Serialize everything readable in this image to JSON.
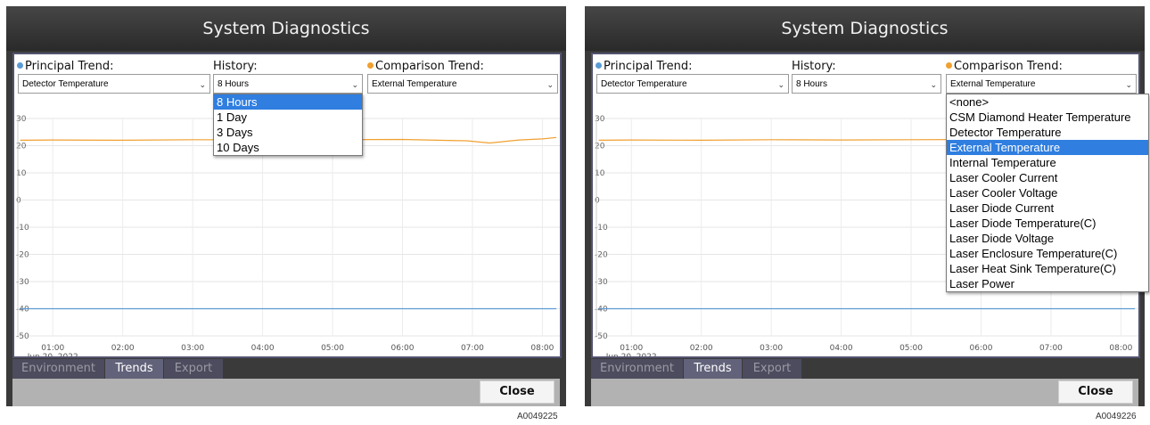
{
  "title": "System Diagnostics",
  "principal_label": "Principal Trend:",
  "history_label": "History:",
  "comparison_label": "Comparison Trend:",
  "colors": {
    "principal": "#5b9bd5",
    "comparison": "#f0a030",
    "selected_option": "#2f7ee0"
  },
  "panels": [
    {
      "principal_value": "Detector Temperature",
      "history_value": "8 Hours",
      "comparison_value": "External Temperature",
      "open_dropdown": "history",
      "dropdown_options": [
        "8 Hours",
        "1 Day",
        "3 Days",
        "10 Days"
      ],
      "selected_option": "8 Hours",
      "figure_code": "A0049225"
    },
    {
      "principal_value": "Detector Temperature",
      "history_value": "8 Hours",
      "comparison_value": "External Temperature",
      "open_dropdown": "comparison",
      "dropdown_options": [
        "<none>",
        "CSM Diamond Heater Temperature",
        "Detector Temperature",
        "External Temperature",
        "Internal Temperature",
        "Laser Cooler Current",
        "Laser Cooler Voltage",
        "Laser Diode Current",
        "Laser Diode Temperature(C)",
        "Laser Diode Voltage",
        "Laser Enclosure Temperature(C)",
        "Laser Heat Sink Temperature(C)",
        "Laser Power"
      ],
      "selected_option": "External Temperature",
      "figure_code": "A0049226"
    }
  ],
  "tabs": [
    "Environment",
    "Trends",
    "Export"
  ],
  "active_tab": "Trends",
  "close_label": "Close",
  "chart_data": {
    "type": "line",
    "x_ticks": [
      "01:00",
      "02:00",
      "03:00",
      "04:00",
      "05:00",
      "06:00",
      "07:00",
      "08:00"
    ],
    "x_date_label": "Jun 20, 2022",
    "y_ticks": [
      30,
      20,
      10,
      0,
      -10,
      -20,
      -30,
      -40,
      -50
    ],
    "ylim": [
      -50,
      30
    ],
    "grid": true,
    "series": [
      {
        "color": "#f0a030",
        "x": [
          "00:32",
          "01:00",
          "02:00",
          "03:00",
          "04:00",
          "05:00",
          "06:00",
          "06:30",
          "06:55",
          "07:15",
          "07:40",
          "08:00",
          "08:12"
        ],
        "values": [
          22,
          22.1,
          22,
          22.2,
          22.1,
          22.2,
          22.3,
          22,
          21.8,
          21,
          22.1,
          22.5,
          23
        ]
      },
      {
        "color": "#5b9bd5",
        "x": [
          "00:32",
          "08:12"
        ],
        "values": [
          -40,
          -40
        ]
      }
    ]
  }
}
